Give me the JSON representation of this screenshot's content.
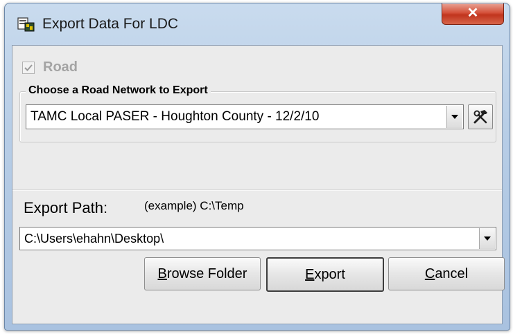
{
  "window": {
    "title": "Export Data For LDC",
    "close_glyph": "✕",
    "app_icon": "export-app-icon"
  },
  "road": {
    "checkbox_label": "Road",
    "checked": true,
    "enabled": false
  },
  "network_group": {
    "legend": "Choose a Road Network to Export",
    "selected_network": "TAMC Local PASER - Houghton County - 12/2/10",
    "tool_icon": "hammer-wrench-icon"
  },
  "export_path": {
    "label": "Export Path:",
    "example": "(example) C:\\Temp",
    "value": "C:\\Users\\ehahn\\Desktop\\"
  },
  "buttons": {
    "browse": {
      "mnemonic": "B",
      "rest": "rowse Folder"
    },
    "export": {
      "mnemonic": "E",
      "rest": "xport"
    },
    "cancel": {
      "mnemonic": "C",
      "rest": "ancel"
    }
  },
  "colors": {
    "close_button": "#c94430",
    "client_bg": "#ebebeb",
    "disabled_text": "#a4a4a4"
  }
}
